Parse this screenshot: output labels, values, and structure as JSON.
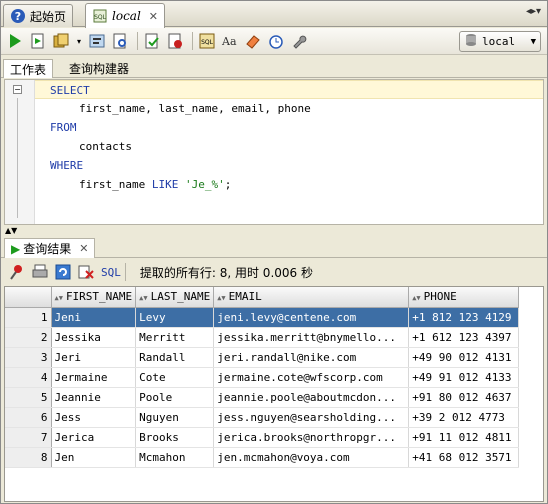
{
  "tabs": [
    {
      "label": "起始页",
      "active": false
    },
    {
      "label": "local",
      "active": true
    }
  ],
  "tab_menu_glyph": "◂▸▾",
  "connection": {
    "label": "local"
  },
  "subtabs": [
    {
      "label": "工作表",
      "active": true
    },
    {
      "label": "查询构建器",
      "active": false
    }
  ],
  "editor": {
    "lines": [
      "SELECT",
      "first_name, last_name, email, phone",
      "FROM",
      "contacts",
      "WHERE",
      "first_name LIKE 'Je_%';"
    ]
  },
  "results": {
    "tab_label": "查询结果",
    "sql_label": "SQL",
    "status": "提取的所有行: 8, 用时 0.006 秒",
    "columns": [
      "FIRST_NAME",
      "LAST_NAME",
      "EMAIL",
      "PHONE"
    ],
    "rows": [
      {
        "n": "1",
        "first": "Jeni",
        "last": "Levy",
        "email": "jeni.levy@centene.com",
        "phone": "+1 812 123 4129"
      },
      {
        "n": "2",
        "first": "Jessika",
        "last": "Merritt",
        "email": "jessika.merritt@bnymello...",
        "phone": "+1 612 123 4397"
      },
      {
        "n": "3",
        "first": "Jeri",
        "last": "Randall",
        "email": "jeri.randall@nike.com",
        "phone": "+49 90 012 4131"
      },
      {
        "n": "4",
        "first": "Jermaine",
        "last": "Cote",
        "email": "jermaine.cote@wfscorp.com",
        "phone": "+49 91 012 4133"
      },
      {
        "n": "5",
        "first": "Jeannie",
        "last": "Poole",
        "email": "jeannie.poole@aboutmcdon...",
        "phone": "+91 80 012 4637"
      },
      {
        "n": "6",
        "first": "Jess",
        "last": "Nguyen",
        "email": "jess.nguyen@searsholding...",
        "phone": "+39 2 012 4773"
      },
      {
        "n": "7",
        "first": "Jerica",
        "last": "Brooks",
        "email": "jerica.brooks@northropgr...",
        "phone": "+91 11 012 4811"
      },
      {
        "n": "8",
        "first": "Jen",
        "last": "Mcmahon",
        "email": "jen.mcmahon@voya.com",
        "phone": "+41 68 012 3571"
      }
    ],
    "selected_row": 1
  },
  "colors": {
    "keyword": "#1f3ca8",
    "string": "#1a7a1a",
    "selection": "#3d6ea5",
    "play": "#1d9b1d"
  }
}
